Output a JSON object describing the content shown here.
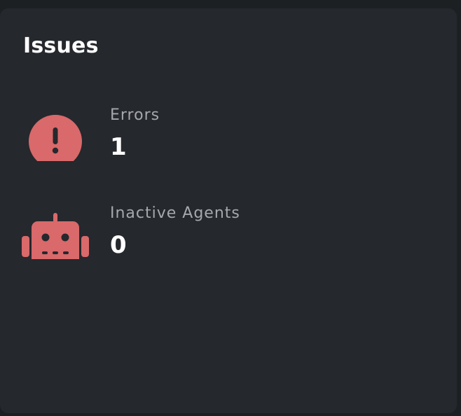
{
  "panel": {
    "title": "Issues"
  },
  "metrics": [
    {
      "label": "Errors",
      "value": "1",
      "icon": "exclamation-circle-icon"
    },
    {
      "label": "Inactive Agents",
      "value": "0",
      "icon": "robot-icon"
    }
  ],
  "colors": {
    "icon_accent": "#d9696a",
    "card_background": "#25282d",
    "page_background": "#1d2023",
    "label_text": "#a6a8ac",
    "value_text": "#ffffff"
  }
}
